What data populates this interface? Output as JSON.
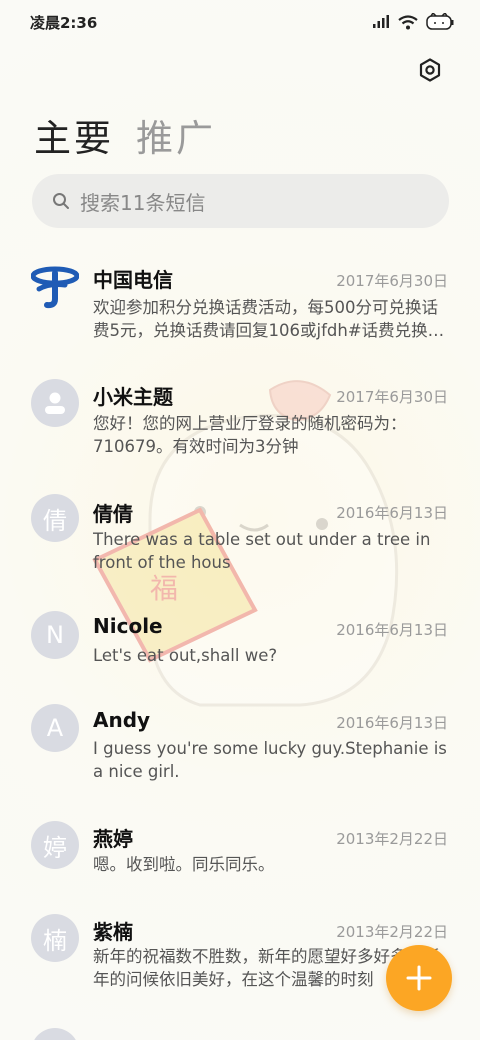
{
  "status_bar": {
    "time": "凌晨2:36",
    "icons": [
      "signal-icon",
      "wifi-icon",
      "battery-icon"
    ]
  },
  "header": {
    "settings_icon": "gear-icon",
    "tabs": [
      {
        "label": "主要",
        "active": true
      },
      {
        "label": "推广",
        "active": false
      }
    ]
  },
  "search": {
    "icon": "search-icon",
    "placeholder": "搜索11条短信"
  },
  "conversations": [
    {
      "name": "中国电信",
      "date": "2017年6月30日",
      "avatar": "",
      "avatar_type": "china-telecom-logo",
      "preview": "欢迎参加积分兑换话费活动，每500分可兑换话费5元，兑换话费请回复106或jfdh#话费兑换编码"
    },
    {
      "name": "小米主题",
      "date": "2017年6月30日",
      "avatar": "",
      "avatar_type": "person-icon",
      "preview": "您好！您的网上营业厅登录的随机密码为：710679。有效时间为3分钟"
    },
    {
      "name": "倩倩",
      "date": "2016年6月13日",
      "avatar": "倩",
      "avatar_type": "letter",
      "preview": "There was a table set out under a tree in front of the hous"
    },
    {
      "name": "Nicole",
      "date": "2016年6月13日",
      "avatar": "N",
      "avatar_type": "letter",
      "preview": "Let's eat out,shall we?"
    },
    {
      "name": "Andy",
      "date": "2016年6月13日",
      "avatar": "A",
      "avatar_type": "letter",
      "preview": "I guess you're some lucky guy.Stephanie is a nice girl."
    },
    {
      "name": "燕婷",
      "date": "2013年2月22日",
      "avatar": "婷",
      "avatar_type": "letter",
      "preview": "嗯。收到啦。同乐同乐。"
    },
    {
      "name": "紫楠",
      "date": "2013年2月22日",
      "avatar": "楠",
      "avatar_type": "letter",
      "preview": "新年的祝福数不胜数，新年的愿望好多好多，新年的问候依旧美好，在这个温馨的时刻"
    }
  ],
  "fab": {
    "icon": "plus-icon"
  },
  "colors": {
    "accent": "#fca624",
    "telecom_blue": "#1f5bb5",
    "avatar_bg": "#d9dbe2"
  }
}
